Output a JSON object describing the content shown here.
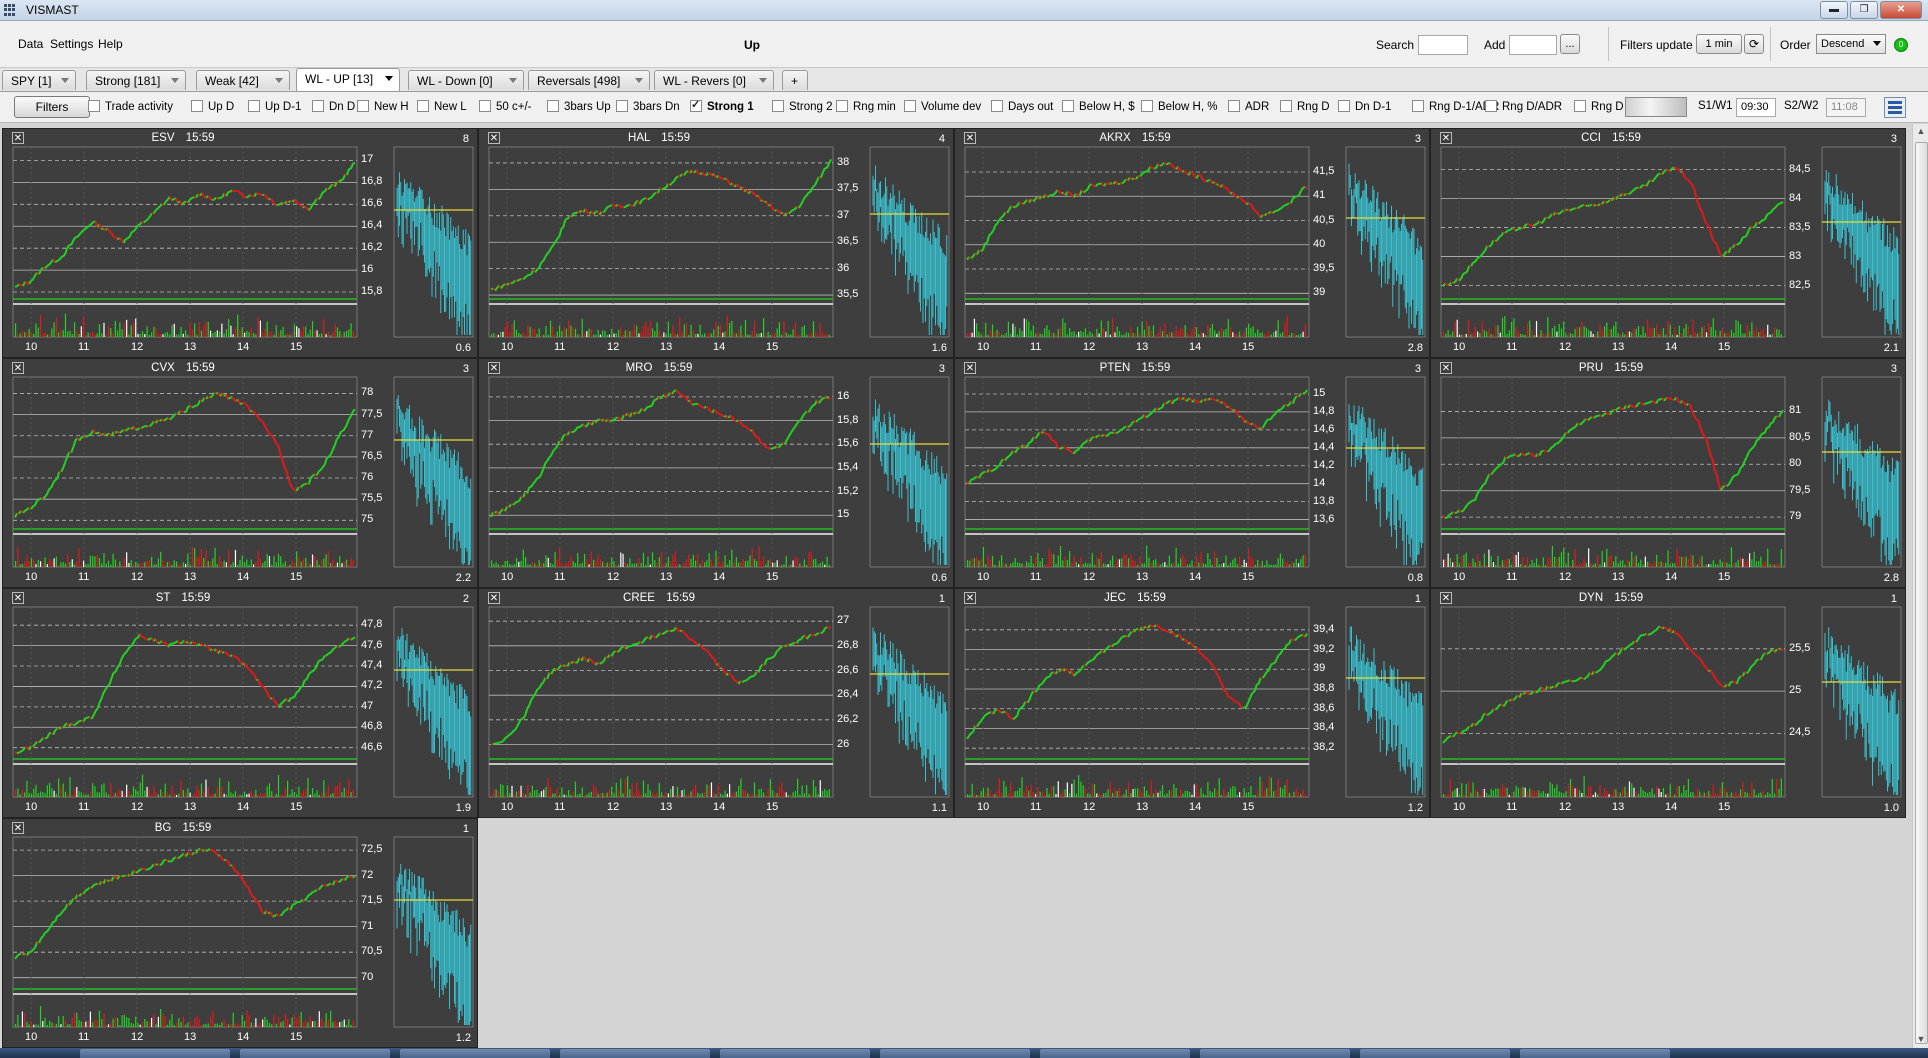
{
  "window": {
    "title": "VISMAST",
    "min_label": "▬",
    "max_label": "❐",
    "close_label": "✕"
  },
  "menu": {
    "items": [
      "Data",
      "Settings",
      "Help"
    ]
  },
  "toolbar": {
    "center_title": "Up",
    "search_label": "Search",
    "add_label": "Add",
    "add_browse_label": "...",
    "filters_update_label": "Filters update",
    "filters_update_value": "1 min",
    "order_label": "Order",
    "order_value": "Descend",
    "status_value": "0"
  },
  "tabs": [
    {
      "label": "SPY   [1]",
      "active": false
    },
    {
      "label": "Strong   [181]",
      "active": false
    },
    {
      "label": "Weak   [42]",
      "active": false
    },
    {
      "label": "WL - UP   [13]",
      "active": true
    },
    {
      "label": "WL - Down   [0]",
      "active": false
    },
    {
      "label": "Reversals   [498]",
      "active": false
    },
    {
      "label": "WL - Revers   [0]",
      "active": false
    },
    {
      "label": "+",
      "active": false
    }
  ],
  "filters": {
    "button_label": "Filters",
    "checkboxes": [
      {
        "label": "Trade activity",
        "checked": false
      },
      {
        "label": "Up D",
        "checked": false
      },
      {
        "label": "Up D-1",
        "checked": false
      },
      {
        "label": "Dn D",
        "checked": false
      },
      {
        "label": "New H",
        "checked": false
      },
      {
        "label": "New L",
        "checked": false
      },
      {
        "label": "50 c+/-",
        "checked": false
      },
      {
        "label": "3bars Up",
        "checked": false
      },
      {
        "label": "3bars Dn",
        "checked": false
      },
      {
        "label": "Strong 1",
        "checked": true
      },
      {
        "label": "Strong 2",
        "checked": false
      },
      {
        "label": "Rng min",
        "checked": false
      },
      {
        "label": "Volume dev",
        "checked": false
      },
      {
        "label": "Days out",
        "checked": false
      },
      {
        "label": "Below H, $",
        "checked": false
      },
      {
        "label": "Below H, %",
        "checked": false
      },
      {
        "label": "ADR",
        "checked": false
      },
      {
        "label": "Rng D",
        "checked": false
      },
      {
        "label": "Dn D-1",
        "checked": false
      },
      {
        "label": "Rng D-1/ADR",
        "checked": false
      },
      {
        "label": "Rng D/ADR",
        "checked": false
      },
      {
        "label": "Rng D",
        "checked": false
      }
    ],
    "s1w1_label": "S1/W1",
    "s1w1_value": "09:30",
    "s2w2_label": "S2/W2",
    "s2w2_value": "11:08"
  },
  "chart_data": [
    {
      "type": "line",
      "symbol": "ESV",
      "time": "15:59",
      "count": "8",
      "ratio": "0.6",
      "yticks": [
        "17",
        "16,8",
        "16,6",
        "16,4",
        "16,2",
        "16",
        "15,8"
      ],
      "xticks": [
        "10",
        "11",
        "12",
        "13",
        "14",
        "15"
      ],
      "ylim": [
        15.7,
        17.05
      ],
      "prices": [
        15.84,
        15.9,
        16.04,
        16.12,
        16.3,
        16.44,
        16.36,
        16.26,
        16.4,
        16.52,
        16.66,
        16.6,
        16.7,
        16.64,
        16.72,
        16.68,
        16.7,
        16.6,
        16.64,
        16.56,
        16.72,
        16.8,
        16.98
      ]
    },
    {
      "type": "line",
      "symbol": "HAL",
      "time": "15:59",
      "count": "4",
      "ratio": "1.6",
      "yticks": [
        "38",
        "37,5",
        "37",
        "36,5",
        "36",
        "35,5"
      ],
      "xticks": [
        "10",
        "11",
        "12",
        "13",
        "14",
        "15"
      ],
      "ylim": [
        35.35,
        38.15
      ],
      "prices": [
        35.6,
        35.7,
        35.8,
        36.0,
        36.4,
        37.0,
        37.1,
        37.05,
        37.2,
        37.2,
        37.3,
        37.5,
        37.7,
        37.85,
        37.8,
        37.7,
        37.55,
        37.4,
        37.2,
        37.0,
        37.2,
        37.6,
        38.05
      ]
    },
    {
      "type": "line",
      "symbol": "AKRX",
      "time": "15:59",
      "count": "3",
      "ratio": "2.8",
      "yticks": [
        "41,5",
        "41",
        "40,5",
        "40",
        "39,5",
        "39"
      ],
      "xticks": [
        "10",
        "11",
        "12",
        "13",
        "14",
        "15"
      ],
      "ylim": [
        38.8,
        41.85
      ],
      "prices": [
        39.7,
        39.9,
        40.5,
        40.8,
        40.9,
        41.0,
        41.1,
        41.0,
        41.2,
        41.25,
        41.3,
        41.4,
        41.6,
        41.7,
        41.5,
        41.4,
        41.3,
        41.1,
        40.9,
        40.6,
        40.7,
        40.9,
        41.2
      ]
    },
    {
      "type": "line",
      "symbol": "CCI",
      "time": "15:59",
      "count": "3",
      "ratio": "2.1",
      "yticks": [
        "84,5",
        "84",
        "83,5",
        "83",
        "82,5"
      ],
      "xticks": [
        "10",
        "11",
        "12",
        "13",
        "14",
        "15"
      ],
      "ylim": [
        82.2,
        84.75
      ],
      "prices": [
        82.5,
        82.6,
        82.9,
        83.2,
        83.4,
        83.5,
        83.55,
        83.7,
        83.8,
        83.85,
        83.9,
        84.0,
        84.1,
        84.2,
        84.4,
        84.55,
        84.3,
        83.6,
        83.0,
        83.2,
        83.5,
        83.7,
        83.95
      ]
    },
    {
      "type": "line",
      "symbol": "CVX",
      "time": "15:59",
      "count": "3",
      "ratio": "2.2",
      "yticks": [
        "78",
        "77,5",
        "77",
        "76,5",
        "76",
        "75,5",
        "75"
      ],
      "xticks": [
        "10",
        "11",
        "12",
        "13",
        "14",
        "15"
      ],
      "ylim": [
        74.7,
        78.2
      ],
      "prices": [
        75.1,
        75.3,
        75.6,
        76.2,
        76.9,
        77.1,
        77.0,
        77.1,
        77.2,
        77.3,
        77.4,
        77.6,
        77.8,
        78.0,
        77.9,
        77.7,
        77.3,
        76.8,
        75.7,
        75.9,
        76.3,
        77.0,
        77.6
      ]
    },
    {
      "type": "line",
      "symbol": "MRO",
      "time": "15:59",
      "count": "3",
      "ratio": "0.6",
      "yticks": [
        "16",
        "15,8",
        "15,6",
        "15,4",
        "15,2",
        "15"
      ],
      "xticks": [
        "10",
        "11",
        "12",
        "13",
        "14",
        "15"
      ],
      "ylim": [
        14.85,
        16.1
      ],
      "prices": [
        15.0,
        15.05,
        15.15,
        15.3,
        15.55,
        15.7,
        15.75,
        15.8,
        15.8,
        15.85,
        15.9,
        16.0,
        16.05,
        15.95,
        15.9,
        15.85,
        15.8,
        15.7,
        15.55,
        15.6,
        15.8,
        15.95,
        16.0
      ]
    },
    {
      "type": "line",
      "symbol": "PTEN",
      "time": "15:59",
      "count": "3",
      "ratio": "0.8",
      "yticks": [
        "15",
        "14,8",
        "14,6",
        "14,4",
        "14,2",
        "14",
        "13,8",
        "13,6"
      ],
      "xticks": [
        "10",
        "11",
        "12",
        "13",
        "14",
        "15"
      ],
      "ylim": [
        13.45,
        15.1
      ],
      "prices": [
        14.0,
        14.1,
        14.2,
        14.35,
        14.45,
        14.6,
        14.4,
        14.35,
        14.5,
        14.55,
        14.6,
        14.7,
        14.8,
        14.9,
        14.95,
        14.9,
        14.95,
        14.85,
        14.7,
        14.6,
        14.8,
        14.9,
        15.05
      ]
    },
    {
      "type": "line",
      "symbol": "PRU",
      "time": "15:59",
      "count": "3",
      "ratio": "2.8",
      "yticks": [
        "81",
        "80,5",
        "80",
        "79,5",
        "79"
      ],
      "xticks": [
        "10",
        "11",
        "12",
        "13",
        "14",
        "15"
      ],
      "ylim": [
        78.7,
        81.5
      ],
      "prices": [
        79.0,
        79.1,
        79.3,
        79.8,
        80.1,
        80.2,
        80.15,
        80.3,
        80.6,
        80.8,
        80.9,
        81.0,
        81.1,
        81.15,
        81.2,
        81.25,
        81.1,
        80.5,
        79.5,
        79.8,
        80.3,
        80.7,
        81.0
      ]
    },
    {
      "type": "line",
      "symbol": "ST",
      "time": "15:59",
      "count": "2",
      "ratio": "1.9",
      "yticks": [
        "47,8",
        "47,6",
        "47,4",
        "47,2",
        "47",
        "46,8",
        "46,6"
      ],
      "xticks": [
        "10",
        "11",
        "12",
        "13",
        "14",
        "15"
      ],
      "ylim": [
        46.45,
        47.9
      ],
      "prices": [
        46.55,
        46.6,
        46.7,
        46.8,
        46.85,
        46.9,
        47.2,
        47.5,
        47.7,
        47.65,
        47.6,
        47.65,
        47.6,
        47.55,
        47.5,
        47.4,
        47.2,
        47.0,
        47.1,
        47.3,
        47.5,
        47.6,
        47.7
      ]
    },
    {
      "type": "line",
      "symbol": "CREE",
      "time": "15:59",
      "count": "1",
      "ratio": "1.1",
      "yticks": [
        "27",
        "26,8",
        "26,6",
        "26,4",
        "26,2",
        "26"
      ],
      "xticks": [
        "10",
        "11",
        "12",
        "13",
        "14",
        "15"
      ],
      "ylim": [
        25.85,
        27.05
      ],
      "prices": [
        26.0,
        26.05,
        26.2,
        26.45,
        26.6,
        26.65,
        26.7,
        26.65,
        26.75,
        26.8,
        26.85,
        26.9,
        26.95,
        26.85,
        26.75,
        26.6,
        26.5,
        26.55,
        26.7,
        26.8,
        26.85,
        26.9,
        26.95
      ]
    },
    {
      "type": "line",
      "symbol": "JEC",
      "time": "15:59",
      "count": "1",
      "ratio": "1.2",
      "yticks": [
        "39,4",
        "39,2",
        "39",
        "38,8",
        "38,6",
        "38,4",
        "38,2"
      ],
      "xticks": [
        "10",
        "11",
        "12",
        "13",
        "14",
        "15"
      ],
      "ylim": [
        38.05,
        39.55
      ],
      "prices": [
        38.3,
        38.5,
        38.6,
        38.5,
        38.7,
        38.9,
        39.0,
        38.95,
        39.1,
        39.2,
        39.3,
        39.4,
        39.45,
        39.4,
        39.3,
        39.2,
        39.0,
        38.7,
        38.6,
        38.9,
        39.1,
        39.3,
        39.35
      ]
    },
    {
      "type": "line",
      "symbol": "DYN",
      "time": "15:59",
      "count": "1",
      "ratio": "1.0",
      "yticks": [
        "25,5",
        "25",
        "24,5"
      ],
      "xticks": [
        "10",
        "11",
        "12",
        "13",
        "14",
        "15"
      ],
      "ylim": [
        24.15,
        25.9
      ],
      "prices": [
        24.4,
        24.5,
        24.6,
        24.75,
        24.85,
        24.95,
        25.0,
        25.05,
        25.1,
        25.15,
        25.25,
        25.4,
        25.55,
        25.65,
        25.75,
        25.7,
        25.5,
        25.3,
        25.05,
        25.1,
        25.3,
        25.45,
        25.5
      ]
    },
    {
      "type": "line",
      "symbol": "BG",
      "time": "15:59",
      "count": "1",
      "ratio": "1.2",
      "yticks": [
        "72,5",
        "72",
        "71,5",
        "71",
        "70,5",
        "70"
      ],
      "xticks": [
        "10",
        "11",
        "12",
        "13",
        "14",
        "15"
      ],
      "ylim": [
        69.7,
        72.6
      ],
      "prices": [
        70.4,
        70.5,
        70.9,
        71.3,
        71.6,
        71.8,
        71.9,
        72.0,
        72.1,
        72.2,
        72.3,
        72.4,
        72.5,
        72.45,
        72.2,
        71.8,
        71.3,
        71.2,
        71.4,
        71.6,
        71.8,
        71.9,
        72.0
      ]
    }
  ],
  "colors": {
    "panel_bg": "#3e3e3e",
    "up": "#22d422",
    "down": "#e01a1a",
    "histo": "#39c0d0",
    "level_yellow": "#e8dc3a",
    "support_green": "#21c021"
  }
}
